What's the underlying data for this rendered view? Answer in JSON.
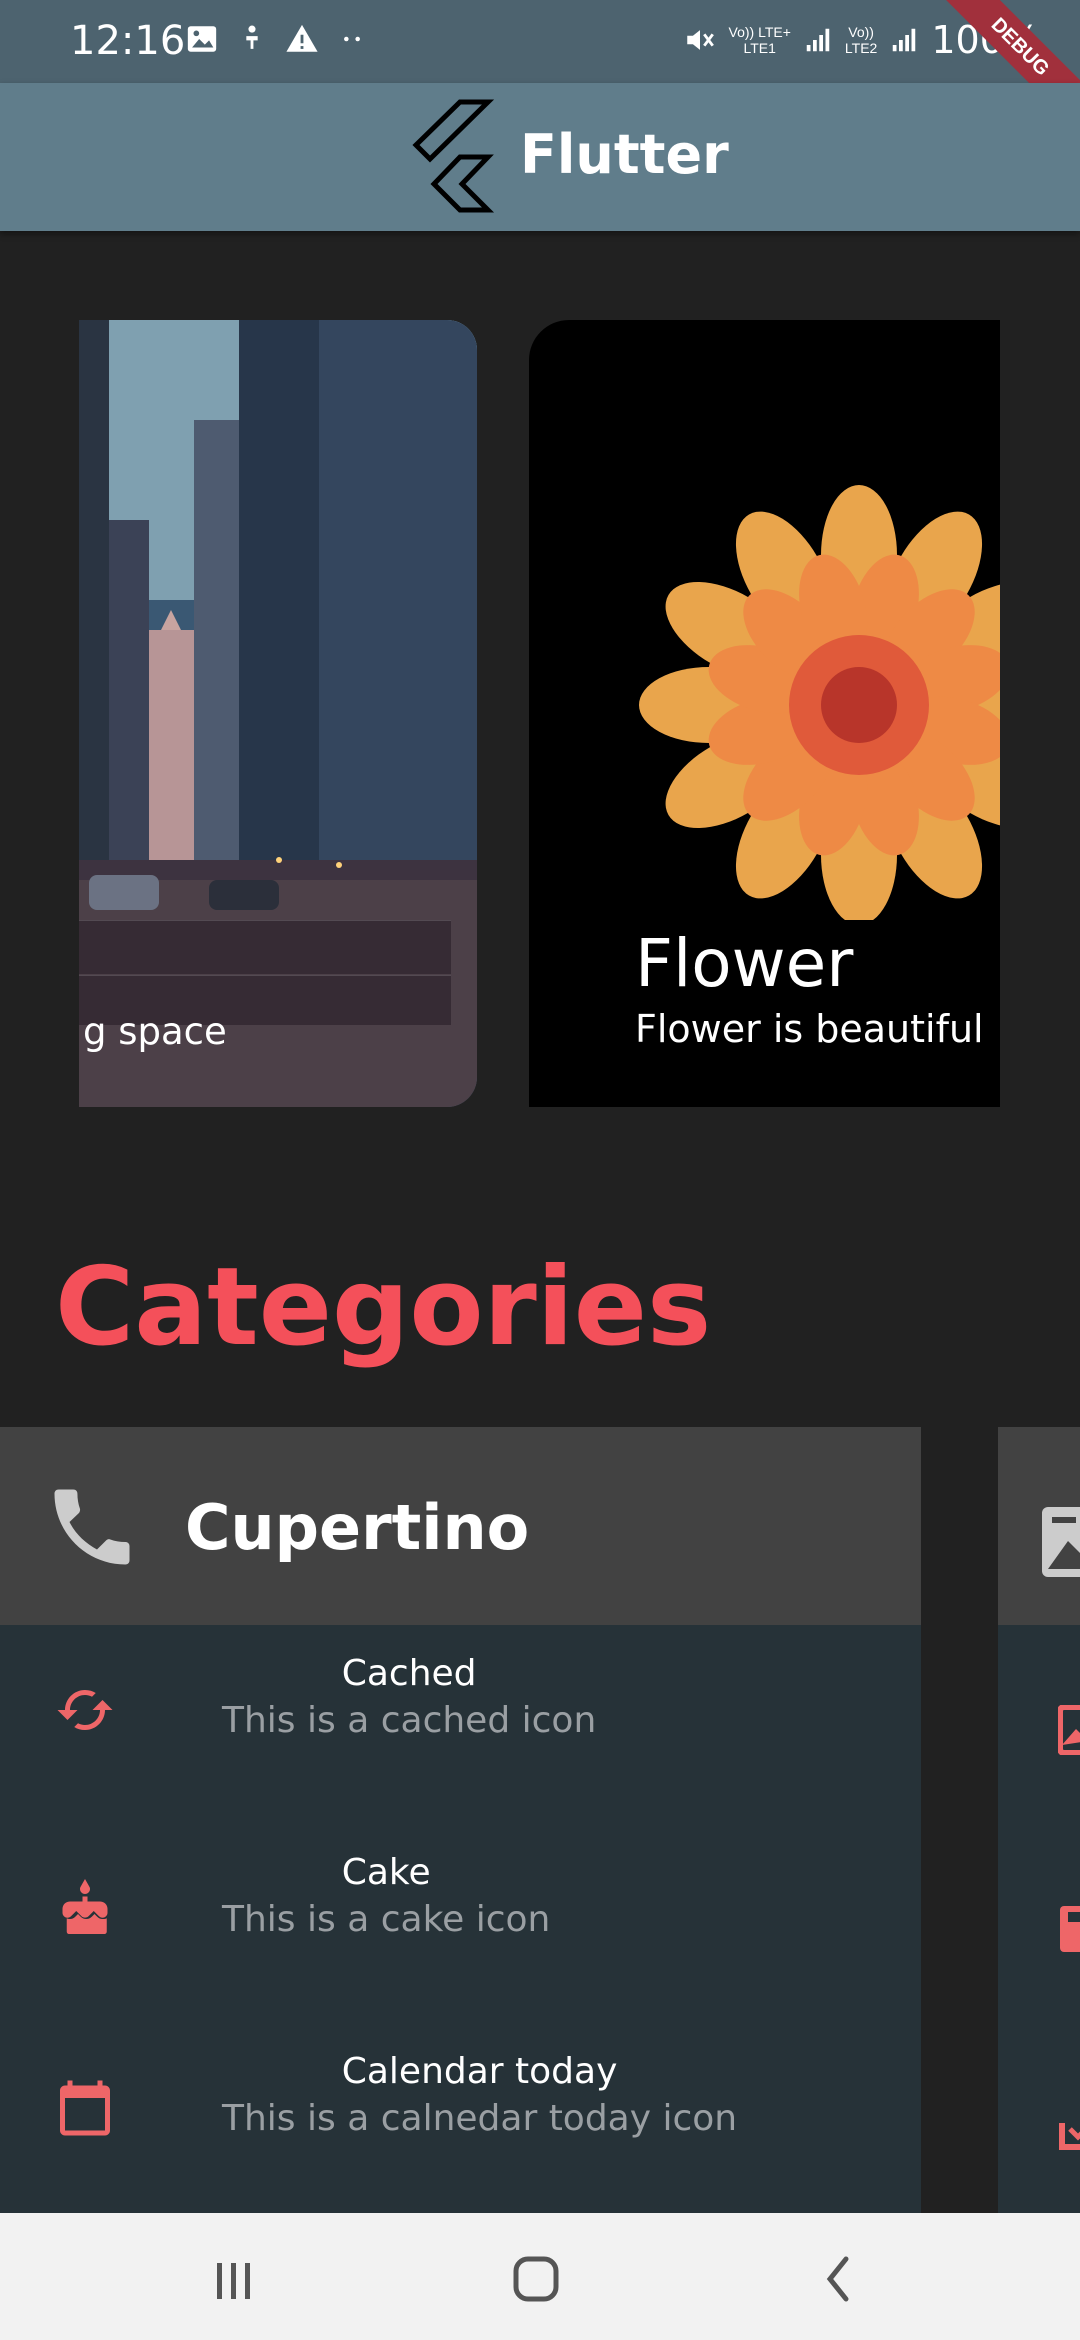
{
  "status_bar": {
    "time": "12:16",
    "network_1": "Vo)) LTE+\nLTE1",
    "network_2": "Vo))\nLTE2",
    "battery": "100%",
    "left_icons": [
      "image-icon",
      "accessibility-icon",
      "warning-icon",
      "more-dots-icon"
    ]
  },
  "debug_banner": "DEBUG",
  "app_bar": {
    "title": "Flutter",
    "logo": "flutter-logo-icon"
  },
  "carousel": {
    "items": [
      {
        "title": "",
        "caption": "g space",
        "image": "city-street-photo"
      },
      {
        "title": "Flower",
        "caption": "Flower is beautiful",
        "image": "orange-dahlia-photo"
      }
    ]
  },
  "categories": {
    "heading": "Categories",
    "accent_color": "#f4505a",
    "cards": [
      {
        "title": "Cupertino",
        "icon": "phone-icon",
        "items": [
          {
            "title": "Cached",
            "subtitle": "This is a cached icon",
            "icon": "cached-icon"
          },
          {
            "title": "Cake",
            "subtitle": "This is a cake icon",
            "icon": "cake-icon"
          },
          {
            "title": "Calendar today",
            "subtitle": "This is a calnedar today icon",
            "icon": "calendar-today-icon"
          }
        ]
      }
    ]
  },
  "nav_bar": {
    "buttons": [
      "recent-apps-icon",
      "home-icon",
      "back-icon"
    ]
  }
}
